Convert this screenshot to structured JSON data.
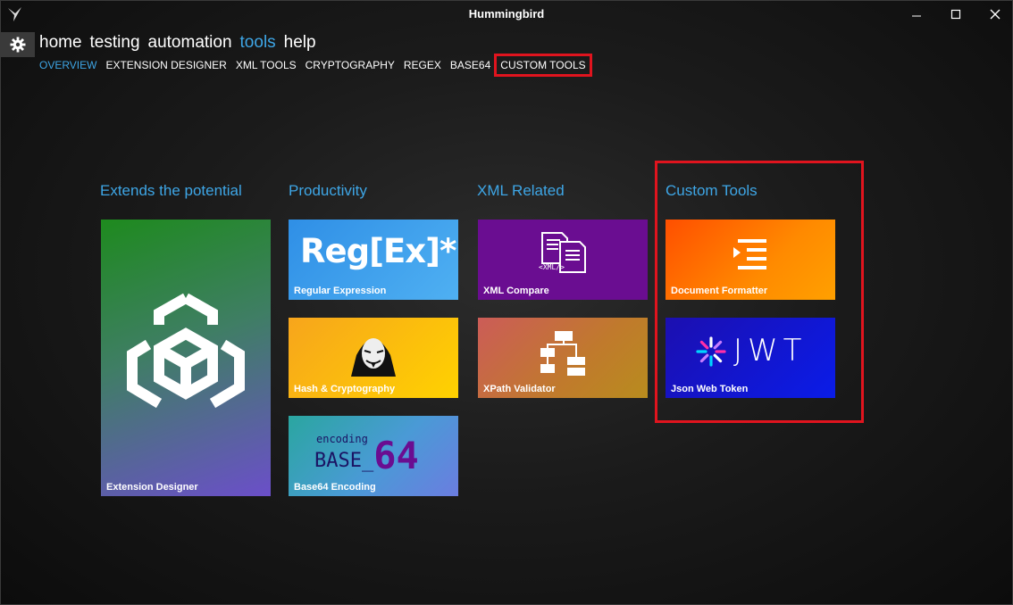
{
  "window": {
    "title": "Hummingbird"
  },
  "main_nav": [
    "home",
    "testing",
    "automation",
    "tools",
    "help"
  ],
  "sub_nav": [
    "OVERVIEW",
    "EXTENSION DESIGNER",
    "XML TOOLS",
    "CRYPTOGRAPHY",
    "REGEX",
    "BASE64",
    "CUSTOM TOOLS"
  ],
  "groups": {
    "extends": {
      "title": "Extends the potential",
      "tiles": [
        {
          "label": "Extension Designer"
        }
      ]
    },
    "productivity": {
      "title": "Productivity",
      "tiles": [
        {
          "label": "Regular Expression",
          "art": "Reg[Ex]*"
        },
        {
          "label": "Hash & Cryptography"
        },
        {
          "label": "Base64 Encoding",
          "art_small": "encoding",
          "art_main": "BASE_",
          "art_num": "64"
        }
      ]
    },
    "xml": {
      "title": "XML Related",
      "tiles": [
        {
          "label": "XML Compare",
          "art": "<XML/>"
        },
        {
          "label": "XPath Validator"
        }
      ]
    },
    "custom": {
      "title": "Custom Tools",
      "tiles": [
        {
          "label": "Document Formatter"
        },
        {
          "label": "Json Web Token",
          "art": "JWT"
        }
      ]
    }
  },
  "colors": {
    "accent": "#3ea6e6",
    "highlight": "#e0141e"
  }
}
